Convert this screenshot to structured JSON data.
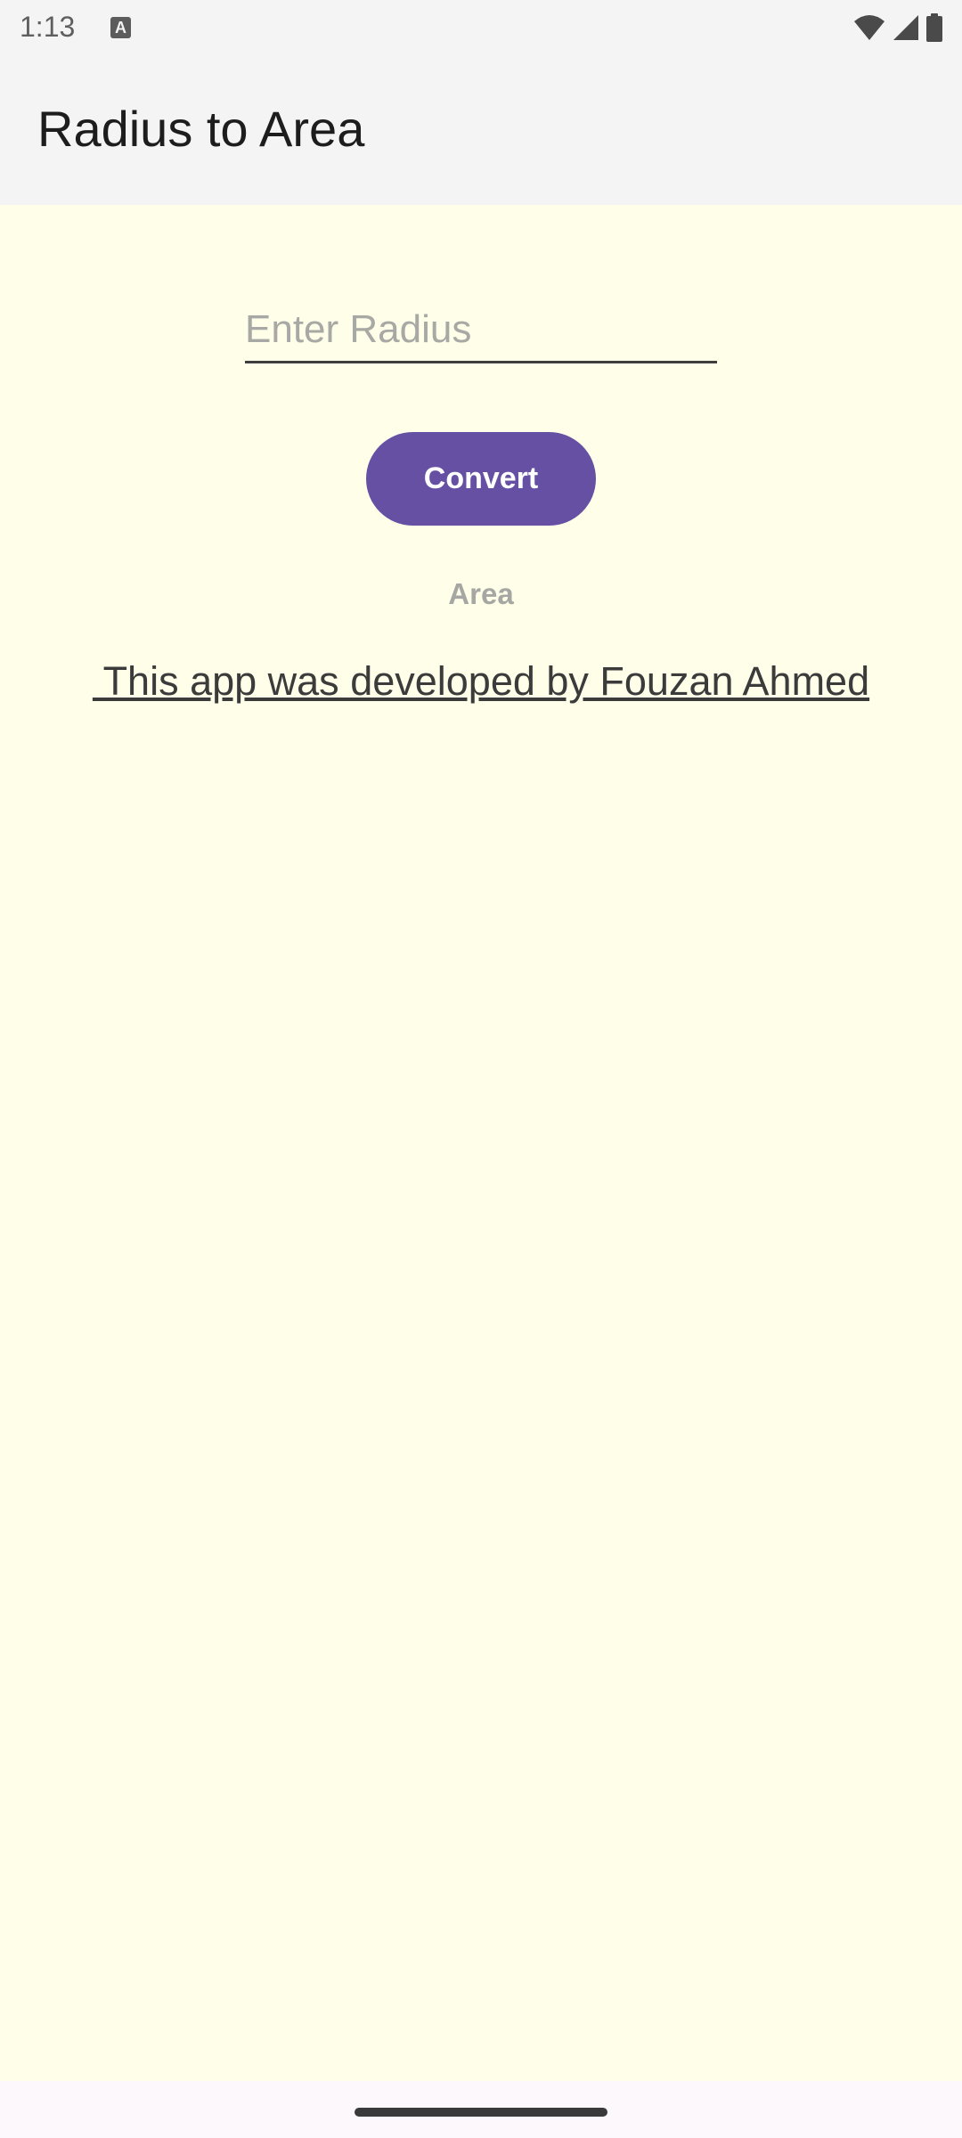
{
  "status_bar": {
    "time": "1:13",
    "notification_icon": "text-a-icon",
    "icons": [
      "wifi-icon",
      "cell-signal-icon",
      "battery-icon"
    ]
  },
  "app_bar": {
    "title": "Radius to Area"
  },
  "form": {
    "radius_input": {
      "value": "",
      "placeholder": "Enter Radius"
    },
    "convert_label": "Convert",
    "area_label": "Area"
  },
  "footer": {
    "credit": " This app was developed by Fouzan Ahmed"
  },
  "colors": {
    "accent": "#6650a3",
    "background": "#fefee9",
    "app_bar": "#f4f4f4"
  }
}
